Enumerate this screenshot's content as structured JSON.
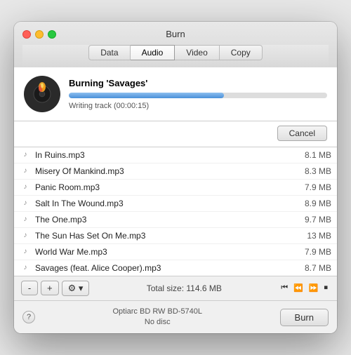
{
  "window": {
    "title": "Burn",
    "tabs": [
      {
        "label": "Data",
        "active": false
      },
      {
        "label": "Audio",
        "active": true
      },
      {
        "label": "Video",
        "active": false
      },
      {
        "label": "Copy",
        "active": false
      }
    ]
  },
  "burn_progress": {
    "title": "Burning 'Savages'",
    "status": "Writing track (00:00:15)",
    "progress_percent": 60,
    "cancel_label": "Cancel"
  },
  "files": [
    {
      "name": "In Ruins.mp3",
      "size": "8.1 MB"
    },
    {
      "name": "Misery Of Mankind.mp3",
      "size": "8.3 MB"
    },
    {
      "name": "Panic Room.mp3",
      "size": "7.9 MB"
    },
    {
      "name": "Salt In The Wound.mp3",
      "size": "8.9 MB"
    },
    {
      "name": "The One.mp3",
      "size": "9.7 MB"
    },
    {
      "name": "The Sun Has Set On Me.mp3",
      "size": "13 MB"
    },
    {
      "name": "World War Me.mp3",
      "size": "7.9 MB"
    },
    {
      "name": "Savages (feat. Alice Cooper).mp3",
      "size": "8.7 MB"
    }
  ],
  "toolbar": {
    "minus_label": "-",
    "plus_label": "+",
    "settings_label": "⚙ ▾",
    "total_size": "Total size: 114.6 MB"
  },
  "footer": {
    "help_label": "?",
    "disc_drive": "Optiarc BD RW BD-5740L",
    "disc_status": "No disc",
    "burn_label": "Burn"
  }
}
